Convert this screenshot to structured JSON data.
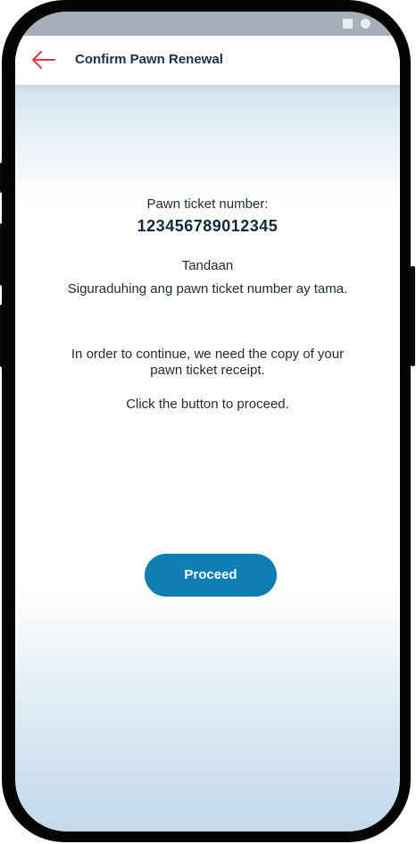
{
  "header": {
    "title": "Confirm Pawn Renewal",
    "back_icon": "back-arrow-icon"
  },
  "main": {
    "ticket_label": "Pawn ticket number:",
    "ticket_number": "123456789012345",
    "reminder_title": "Tandaan",
    "reminder_text": "Siguraduhing ang pawn ticket number ay tama.",
    "instruction_line1": "In order to continue, we need the copy of your",
    "instruction_line2": "pawn ticket receipt.",
    "click_text": "Click the button to proceed."
  },
  "actions": {
    "proceed_label": "Proceed"
  },
  "colors": {
    "accent": "#0f7eb4",
    "back_arrow": "#e0393e",
    "title_text": "#1b3347"
  }
}
